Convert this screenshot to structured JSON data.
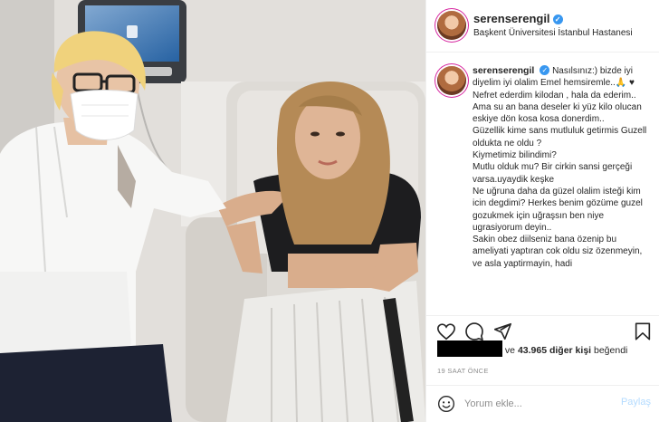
{
  "header": {
    "username": "serenserengil",
    "location": "Başkent Üniversitesi İstanbul Hastanesi"
  },
  "caption": {
    "username": "serenserengil",
    "lines": [
      "Nasılsınız:) bizde iyi diyelim iyi olalim Emel hemsiremle..🙏 ♥",
      "Nefret ederdim kilodan , hala da ederim..",
      "Ama su an bana deseler ki yüz kilo olucan eskiye dön kosa kosa donerdim..",
      "Güzellik kime sans mutluluk getirmis Guzell oldukta ne oldu ?",
      "Kiymetimiz bilindimi?",
      "Mutlu olduk mu? Bir cirkin sansi gerçeği varsa.uyaydik keşke",
      "Ne uğruna daha da güzel olalim isteği kim icin degdimi? Herkes benim gözüme guzel gozukmek için uğraşsın ben niye ugrasiyorum deyin..",
      "Sakin obez diilseniz bana özenip bu ameliyati yaptıran cok oldu siz özenmeyin, ve asla yaptirmayin, hadi"
    ]
  },
  "icons": {
    "like": "heart-icon",
    "comment": "comment-icon",
    "share": "share-icon",
    "save": "bookmark-icon",
    "verified": "verified-badge-icon",
    "emoji": "emoji-icon"
  },
  "likes": {
    "prefix": "ve",
    "count_text": "43.965 diğer kişi",
    "suffix": "beğendi"
  },
  "timestamp": "19 SAAT ÖNCE",
  "comment": {
    "placeholder": "Yorum ekle...",
    "post_label": "Paylaş"
  },
  "colors": {
    "accent": "#3897f0",
    "post_disabled": "#b3dbff",
    "muted": "#8e8e8e"
  }
}
